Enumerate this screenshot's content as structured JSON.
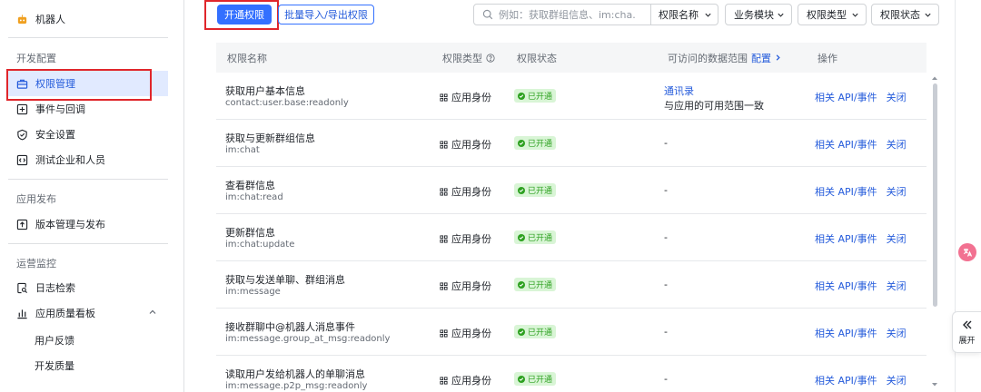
{
  "sidebar": {
    "app_name": "机器人",
    "sections": [
      {
        "title": "开发配置",
        "items": [
          "权限管理",
          "事件与回调",
          "安全设置",
          "测试企业和人员"
        ]
      },
      {
        "title": "应用发布",
        "items": [
          "版本管理与发布"
        ]
      },
      {
        "title": "运营监控",
        "items": [
          "日志检索",
          "应用质量看板"
        ],
        "sub_items": [
          "用户反馈",
          "开发质量"
        ]
      }
    ],
    "active_item": "权限管理"
  },
  "toolbar": {
    "primary_button": "开通权限",
    "batch_button": "批量导入/导出权限",
    "search_placeholder": "例如：获取群组信息、im:cha...",
    "search_field": "权限名称",
    "filters": [
      "业务模块",
      "权限类型",
      "权限状态"
    ]
  },
  "table": {
    "headers": {
      "name": "权限名称",
      "type": "权限类型",
      "status": "权限状态",
      "scope": "可访问的数据范围",
      "scope_link": "配置",
      "ops": "操作"
    },
    "rows": [
      {
        "name": "获取用户基本信息",
        "code": "contact:user.base:readonly",
        "type": "应用身份",
        "status": "已开通",
        "scope_link": "通讯录",
        "scope_text": "与应用的可用范围一致",
        "op1": "相关 API/事件",
        "op2": "关闭"
      },
      {
        "name": "获取与更新群组信息",
        "code": "im:chat",
        "type": "应用身份",
        "status": "已开通",
        "scope_text": "-",
        "op1": "相关 API/事件",
        "op2": "关闭"
      },
      {
        "name": "查看群信息",
        "code": "im:chat:read",
        "type": "应用身份",
        "status": "已开通",
        "scope_text": "-",
        "op1": "相关 API/事件",
        "op2": "关闭"
      },
      {
        "name": "更新群信息",
        "code": "im:chat:update",
        "type": "应用身份",
        "status": "已开通",
        "scope_text": "-",
        "op1": "相关 API/事件",
        "op2": "关闭"
      },
      {
        "name": "获取与发送单聊、群组消息",
        "code": "im:message",
        "type": "应用身份",
        "status": "已开通",
        "scope_text": "-",
        "op1": "相关 API/事件",
        "op2": "关闭"
      },
      {
        "name": "接收群聊中@机器人消息事件",
        "code": "im:message.group_at_msg:readonly",
        "type": "应用身份",
        "status": "已开通",
        "scope_text": "-",
        "op1": "相关 API/事件",
        "op2": "关闭"
      },
      {
        "name": "读取用户发给机器人的单聊消息",
        "code": "im:message.p2p_msg:readonly",
        "type": "应用身份",
        "status": "已开通",
        "scope_text": "-",
        "op1": "相关 API/事件",
        "op2": "关闭"
      }
    ]
  },
  "side_panel": {
    "expand_label": "展开"
  },
  "colors": {
    "accent": "#3370ff",
    "active_bg": "#e1eaff",
    "success": "#2ea121",
    "annotation_red": "#e0262b"
  }
}
